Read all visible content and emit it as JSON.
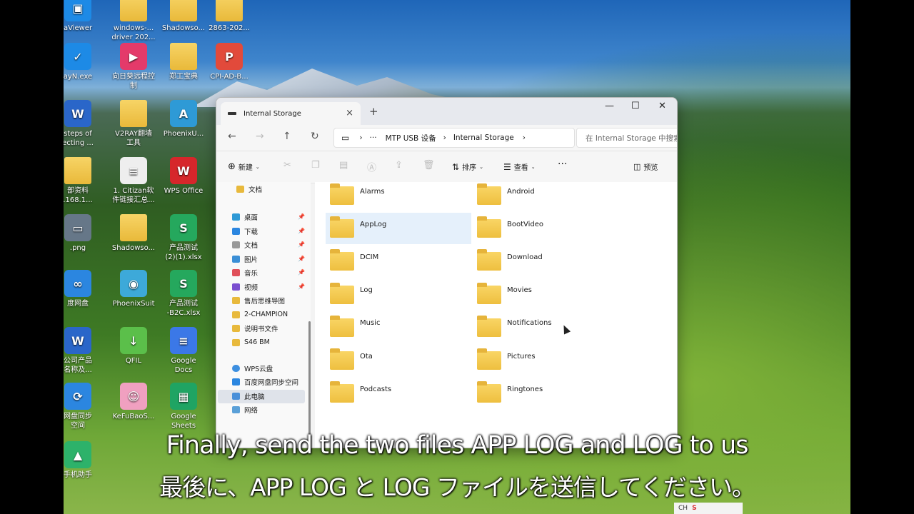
{
  "desktop": {
    "icons": [
      {
        "label": "aViewer",
        "color": "#1d8ae6",
        "glyph": "▣"
      },
      {
        "label": "windows-...\ndriver 202...",
        "color": "folder",
        "glyph": ""
      },
      {
        "label": "Shadowso...",
        "color": "folder",
        "glyph": ""
      },
      {
        "label": "2863-202...",
        "color": "folder",
        "glyph": ""
      },
      {
        "label": "ayN.exe",
        "color": "#1d8ae6",
        "glyph": "✓"
      },
      {
        "label": "向日葵远程控\n制",
        "color": "#e43a6a",
        "glyph": "▶"
      },
      {
        "label": "郑工宝典",
        "color": "folder",
        "glyph": ""
      },
      {
        "label": "CPI-AD-B...",
        "color": "#e24a3b",
        "glyph": "P"
      },
      {
        "label": "steps of\necting ...",
        "color": "#2a66c9",
        "glyph": "W"
      },
      {
        "label": "V2RAY翻墙\n工具",
        "color": "folder",
        "glyph": ""
      },
      {
        "label": "PhoenixU...",
        "color": "#2e9ad6",
        "glyph": "A"
      },
      {
        "label": "部资料\n.168.1...",
        "color": "folder",
        "glyph": ""
      },
      {
        "label": "1. Citizan软\n件链接汇总...",
        "color": "#eeeeee",
        "glyph": "≡"
      },
      {
        "label": "WPS Office",
        "color": "#d6262b",
        "glyph": "W"
      },
      {
        "label": ".png",
        "color": "#667788",
        "glyph": "▭"
      },
      {
        "label": "Shadowso...",
        "color": "folder",
        "glyph": ""
      },
      {
        "label": "产品测试\n(2)(1).xlsx",
        "color": "#25a85d",
        "glyph": "S"
      },
      {
        "label": "度网盘",
        "color": "#2b86e0",
        "glyph": "∞"
      },
      {
        "label": "PhoenixSuit",
        "color": "#3da9d9",
        "glyph": "◉"
      },
      {
        "label": "产品测试\n-B2C.xlsx",
        "color": "#25a85d",
        "glyph": "S"
      },
      {
        "label": "公司产品\n名称及...",
        "color": "#2a66c9",
        "glyph": "W"
      },
      {
        "label": "QFIL",
        "color": "#5bbf4a",
        "glyph": "↓"
      },
      {
        "label": "Google\nDocs",
        "color": "#3b78e7",
        "glyph": "≡"
      },
      {
        "label": "网盘同步\n空间",
        "color": "#2b86e0",
        "glyph": "⟳"
      },
      {
        "label": "KeFuBaoS...",
        "color": "#f0a0c0",
        "glyph": "☺"
      },
      {
        "label": "Google\nSheets",
        "color": "#1fa463",
        "glyph": "▦"
      },
      {
        "label": "手机助手",
        "color": "#2db26a",
        "glyph": "▲"
      }
    ]
  },
  "window": {
    "tab_title": "Internal Storage",
    "tab_close": "×",
    "new_tab": "+",
    "controls": {
      "minimize": "—",
      "maximize": "☐",
      "close": "✕"
    },
    "nav": {
      "back": "←",
      "forward": "→",
      "up": "↑",
      "refresh": "↻"
    },
    "address": {
      "segments": [
        "MTP USB 设备",
        "Internal Storage"
      ],
      "more": "···",
      "sep": "›"
    },
    "search_placeholder": "在 Internal Storage 中搜索",
    "toolbar": {
      "new": "新建",
      "sort": "排序",
      "view": "查看",
      "more": "···",
      "preview": "预览"
    },
    "sidebar": {
      "top_item": "文档",
      "quick": [
        "桌面",
        "下载",
        "文档",
        "图片",
        "音乐",
        "视频"
      ],
      "folders": [
        "售后思维导图",
        "2-CHAMPION",
        "说明书文件",
        "S46 BM"
      ],
      "cloud": [
        "WPS云盘",
        "百度网盘同步空间"
      ],
      "this_pc": "此电脑",
      "network": "网络"
    },
    "files": [
      "Alarms",
      "Android",
      "AppLog",
      "BootVideo",
      "DCIM",
      "Download",
      "Log",
      "Movies",
      "Music",
      "Notifications",
      "Ota",
      "Pictures",
      "Podcasts",
      "Ringtones"
    ],
    "highlighted": "AppLog"
  },
  "subtitles": {
    "en": "Finally, send the two files APP LOG and LOG to us",
    "ja": "最後に、APP LOG と LOG ファイルを送信してください。"
  },
  "taskbar": {
    "ime": "CH",
    "wps": "S"
  }
}
